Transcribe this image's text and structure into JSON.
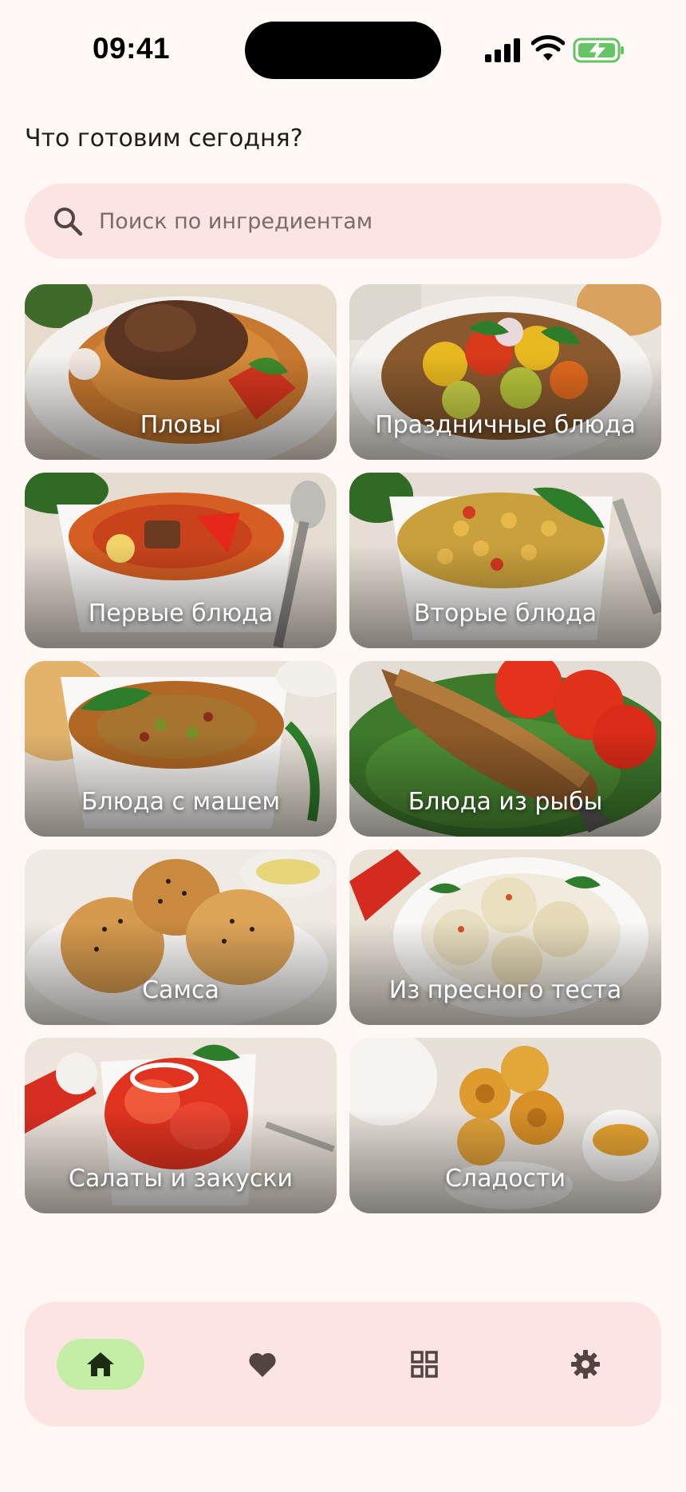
{
  "status_bar": {
    "time": "09:41"
  },
  "header": {
    "greeting": "Что готовим сегодня?"
  },
  "search": {
    "placeholder": "Поиск по ингредиентам",
    "value": ""
  },
  "categories": [
    {
      "label": "Пловы"
    },
    {
      "label": "Праздничные блюда"
    },
    {
      "label": "Первые блюда"
    },
    {
      "label": "Вторые блюда"
    },
    {
      "label": "Блюда с машем"
    },
    {
      "label": "Блюда из рыбы"
    },
    {
      "label": "Самса"
    },
    {
      "label": "Из пресного теста"
    },
    {
      "label": "Салаты и закуски"
    },
    {
      "label": "Сладости"
    }
  ],
  "bottom_nav": {
    "items": [
      {
        "icon": "home-icon",
        "active": true
      },
      {
        "icon": "heart-icon",
        "active": false
      },
      {
        "icon": "grid-icon",
        "active": false
      },
      {
        "icon": "gear-icon",
        "active": false
      }
    ]
  },
  "colors": {
    "background": "#FFF8F4",
    "surface_pink": "#FCE4E2",
    "active_nav_pill": "#C4EEA6",
    "icon": "#534341"
  }
}
